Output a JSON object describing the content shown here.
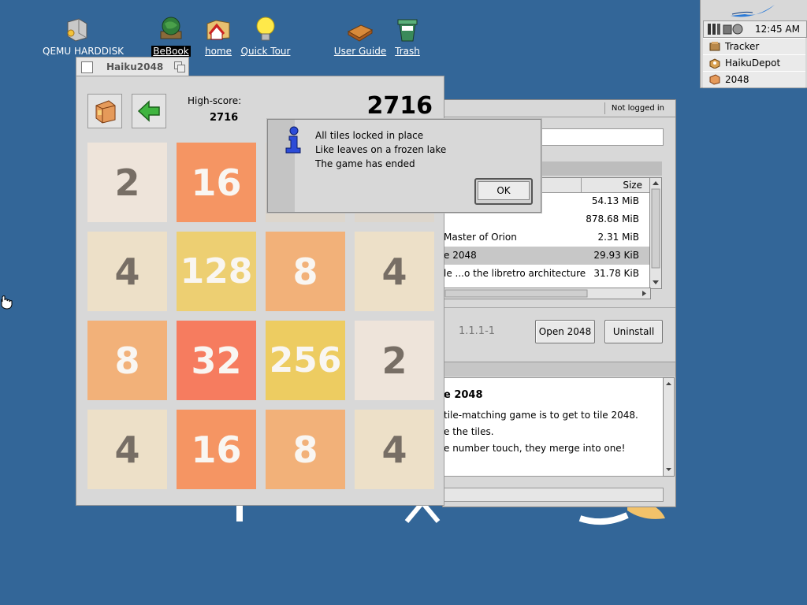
{
  "desktop": {
    "icons": [
      {
        "name": "QEMU HARDDISK",
        "icon": "harddisk-icon"
      },
      {
        "name": "BeBook",
        "icon": "globe-book-icon"
      },
      {
        "name": "home",
        "icon": "home-folder-icon"
      },
      {
        "name": "Quick Tour",
        "icon": "lightbulb-icon"
      },
      {
        "name": "User Guide",
        "icon": "book-icon"
      },
      {
        "name": "Trash",
        "icon": "trash-icon"
      }
    ]
  },
  "deskbar": {
    "clock": "12:45 AM",
    "apps": [
      {
        "label": "Tracker",
        "icon": "tracker-icon"
      },
      {
        "label": "HaikuDepot",
        "icon": "haikudepot-icon"
      },
      {
        "label": "2048",
        "icon": "2048-icon"
      }
    ]
  },
  "depot": {
    "login_status": "Not logged in",
    "size_header": "Size",
    "rows": [
      {
        "name": "",
        "size": "54.13 MiB"
      },
      {
        "name": "",
        "size": "878.68 MiB"
      },
      {
        "name": "Master of Orion",
        "size": "2.31 MiB"
      },
      {
        "name": "e 2048",
        "size": "29.93 KiB"
      },
      {
        "name": "le ...o the libretro architecture",
        "size": "31.78 KiB"
      }
    ],
    "version": "1.1.1-1",
    "open_button": "Open 2048",
    "uninstall_button": "Uninstall",
    "desc_title": "e 2048",
    "desc_lines": [
      "tile-matching game is to get to tile 2048.",
      "e the tiles.",
      "e number touch, they merge into one!"
    ]
  },
  "game": {
    "title": "Haiku2048",
    "highscore_label": "High-score:",
    "highscore_value": "2716",
    "score": "2716",
    "board": [
      [
        "2",
        "16",
        "",
        ""
      ],
      [
        "4",
        "128",
        "8",
        "4"
      ],
      [
        "8",
        "32",
        "256",
        "2"
      ],
      [
        "4",
        "16",
        "8",
        "4"
      ]
    ],
    "tile_colors": {
      "2": "#eee4da",
      "4": "#ede0c8",
      "8": "#f2b179",
      "16": "#f59563",
      "32": "#f67c5f",
      "128": "#edcf72",
      "256": "#edcc61"
    }
  },
  "alert": {
    "lines": [
      "All tiles locked in place",
      "Like leaves on a frozen lake",
      "The game has ended"
    ],
    "ok_label": "OK"
  }
}
